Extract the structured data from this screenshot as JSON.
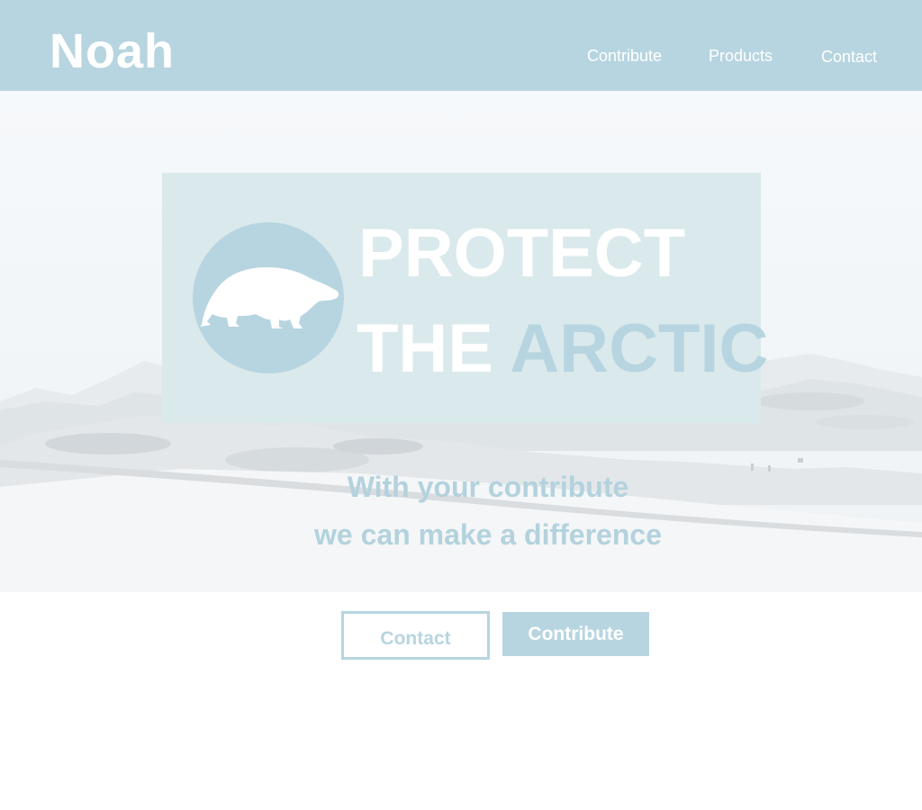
{
  "header": {
    "logo": "Noah",
    "nav": [
      {
        "label": "Contribute"
      },
      {
        "label": "Products"
      },
      {
        "label": "Contact"
      }
    ]
  },
  "hero": {
    "headline_line1": "PROTECT",
    "headline_line2_part1": "THE ",
    "headline_line2_part2": "ARCTIC",
    "tagline_line1": "With your contribute",
    "tagline_line2": "we can make a difference",
    "icon": "polar-bear-icon"
  },
  "actions": {
    "contact_label": "Contact",
    "contribute_label": "Contribute"
  },
  "colors": {
    "brand": "#b7d5e0",
    "banner": "#dae9ec",
    "text_on_brand": "#ffffff"
  }
}
